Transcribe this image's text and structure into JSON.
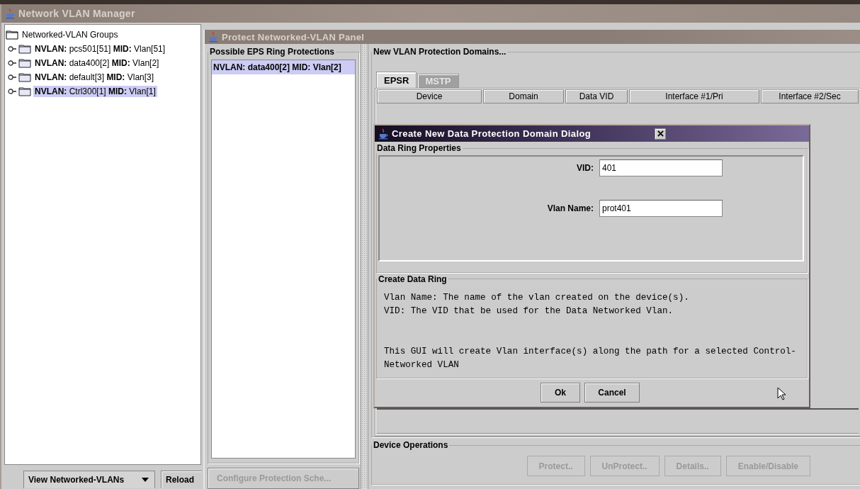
{
  "main_window": {
    "title": "Network VLAN Manager",
    "tree": {
      "label": "Networked-VLAN Groups",
      "children": [
        {
          "label": "**NVLAN:** pcs501[51] **MID:** Vlan[51]",
          "expanded": false,
          "selected": false
        },
        {
          "label": "**NVLAN:** data400[2] **MID:** Vlan[2]",
          "expanded": false,
          "selected": false
        },
        {
          "label": "**NVLAN:** default[3] **MID:** Vlan[3]",
          "expanded": false,
          "selected": false
        },
        {
          "label": "**NVLAN:** Ctrl300[1] **MID:** Vlan[1]",
          "expanded": false,
          "selected": true
        }
      ]
    },
    "view_selector": {
      "value": "View Networked-VLANs"
    },
    "reload_button": {
      "label": "Reload"
    }
  },
  "protect_panel": {
    "title": "Protect Networked-VLAN Panel",
    "ring_protections": {
      "title": "Possible EPS Ring Protections",
      "items": [
        {
          "label": "NVLAN: data400[2] MID: Vlan[2]",
          "selected": true
        }
      ]
    },
    "configure_button": {
      "label": "Configure Protection Sche...",
      "disabled": true
    },
    "domains": {
      "title": "New VLAN Protection Domains...",
      "tabs": [
        {
          "label": "EPSR",
          "selected": true,
          "disabled": false
        },
        {
          "label": "MSTP",
          "selected": false,
          "disabled": true
        }
      ],
      "table": {
        "columns": [
          "Device",
          "Domain",
          "Data VID",
          "Interface #1/Pri",
          "Interface #2/Sec"
        ]
      }
    },
    "device_operations": {
      "title": "Device Operations",
      "buttons": [
        {
          "label": "Protect..",
          "disabled": true
        },
        {
          "label": "UnProtect..",
          "disabled": true
        },
        {
          "label": "Details..",
          "disabled": true
        },
        {
          "label": "Enable/Disable",
          "disabled": true
        }
      ]
    }
  },
  "dialog": {
    "title": "Create New Data Protection Domain Dialog",
    "properties": {
      "title": "Data Ring Properties",
      "fields": [
        {
          "label": "VID:",
          "value": "401"
        },
        {
          "label": "Vlan Name:",
          "value": "prot401"
        }
      ]
    },
    "description": {
      "title": "Create Data Ring",
      "paragraphs": [
        [
          "Vlan Name: The name of the vlan created on the device(s).",
          "VID: The VID that be used for the Data Networked Vlan."
        ],
        [
          "This GUI will create Vlan interface(s) along the path for a selected Control-",
          "Networked VLAN"
        ]
      ]
    },
    "buttons": [
      {
        "label": "Ok"
      },
      {
        "label": "Cancel"
      }
    ]
  }
}
